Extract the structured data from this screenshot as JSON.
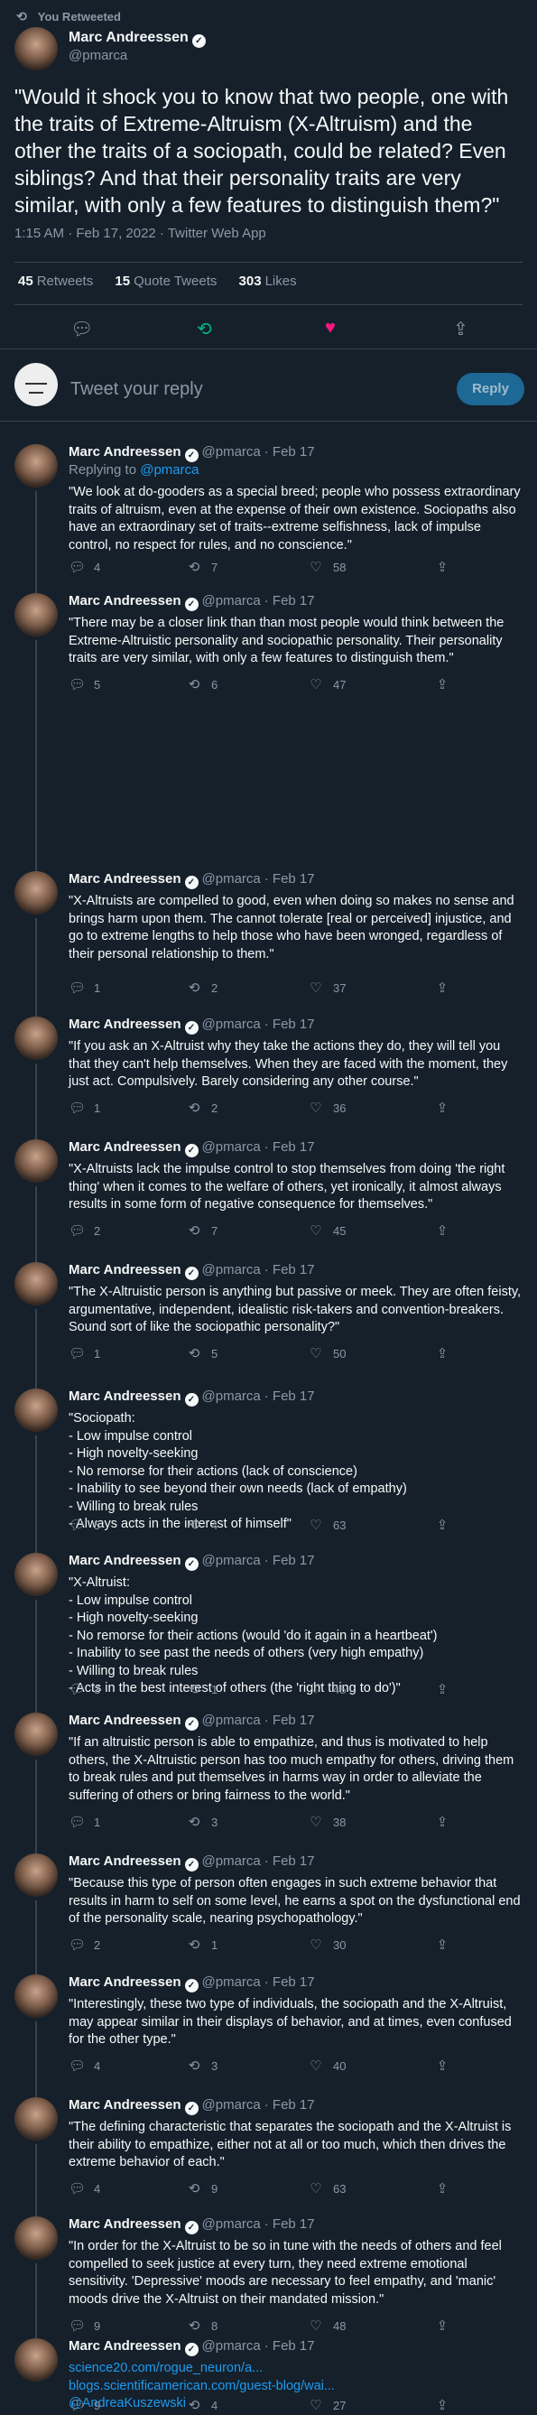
{
  "retweet_banner": "You Retweeted",
  "main": {
    "name": "Marc Andreessen",
    "handle": "@pmarca",
    "text": "\"Would it shock you to know that two people, one with the traits of Extreme-Altruism (X-Altruism) and the other the traits of a sociopath, could be related? Even siblings? And that their personality traits are very similar, with only a few features to distinguish them?\"",
    "meta": "1:15 AM · Feb 17, 2022 · Twitter Web App",
    "stats": {
      "retweets_count": "45",
      "retweets_label": "Retweets",
      "quotes_count": "15",
      "quotes_label": "Quote Tweets",
      "likes_count": "303",
      "likes_label": "Likes"
    },
    "retweet_color": "#00ba7c",
    "like_color": "#f91880"
  },
  "reply_box": {
    "placeholder": "Tweet your reply",
    "button": "Reply"
  },
  "replies": [
    {
      "name": "Marc Andreessen",
      "handle": "@pmarca",
      "date": "· Feb 17",
      "replying_label": "Replying to",
      "replying_to": "@pmarca",
      "text": "\"We look at do-gooders as a special breed; people who possess extraordinary traits of altruism, even at the expense of their own existence. Sociopaths also have an extraordinary set of traits--extreme selfishness, lack of impulse control, no respect for rules, and no conscience.\"",
      "replies": "4",
      "retweets": "7",
      "likes": "58"
    },
    {
      "name": "Marc Andreessen",
      "handle": "@pmarca",
      "date": "· Feb 17",
      "text": "\"There may be a closer link than than most people would think between the Extreme-Altruistic personality and sociopathic personality. Their personality traits are very similar, with only a few features to distinguish them.\"",
      "replies": "5",
      "retweets": "6",
      "likes": "47"
    },
    {
      "name": "Marc Andreessen",
      "handle": "@pmarca",
      "date": "· Feb 17",
      "text": "\"X-Altruists are compelled to good, even when doing so makes no sense and brings harm upon them. The cannot tolerate [real or perceived] injustice, and go to extreme lengths to help those who have been wronged, regardless of their personal relationship to them.\"",
      "replies": "1",
      "retweets": "2",
      "likes": "37"
    },
    {
      "name": "Marc Andreessen",
      "handle": "@pmarca",
      "date": "· Feb 17",
      "text": "\"If you ask an X-Altruist why they take the actions they do, they will tell you that they can't help themselves. When they are faced with the moment, they just act. Compulsively. Barely considering any other course.\"",
      "replies": "1",
      "retweets": "2",
      "likes": "36"
    },
    {
      "name": "Marc Andreessen",
      "handle": "@pmarca",
      "date": "· Feb 17",
      "text": "\"X-Altruists lack the impulse control to stop themselves from doing 'the right thing' when it comes to the welfare of others, yet ironically, it almost always results in some form of negative consequence for themselves.\"",
      "replies": "2",
      "retweets": "7",
      "likes": "45"
    },
    {
      "name": "Marc Andreessen",
      "handle": "@pmarca",
      "date": "· Feb 17",
      "text": "\"The X-Altruistic person is anything but passive or meek. They are often feisty, argumentative, independent, idealistic risk-takers and convention-breakers. Sound sort of like the sociopathic personality?\"",
      "replies": "1",
      "retweets": "5",
      "likes": "50"
    },
    {
      "name": "Marc Andreessen",
      "handle": "@pmarca",
      "date": "· Feb 17",
      "text": "\"Sociopath:\n- Low impulse control\n- High novelty-seeking\n- No remorse for their actions (lack of conscience)\n- Inability to see beyond their own needs (lack of empathy)\n- Willing to break rules\n- Always acts in the interest of himself\"",
      "replies": "5",
      "retweets": "4",
      "likes": "63"
    },
    {
      "name": "Marc Andreessen",
      "handle": "@pmarca",
      "date": "· Feb 17",
      "text": "\"X-Altruist:\n- Low impulse control\n- High novelty-seeking\n- No remorse for their actions (would 'do it again in a heartbeat')\n- Inability to see past the needs of others (very high empathy)\n- Willing to break rules\n- Acts in the best interest of others (the 'right thing to do')\"",
      "replies": "3",
      "retweets": "1",
      "likes": "45"
    },
    {
      "name": "Marc Andreessen",
      "handle": "@pmarca",
      "date": "· Feb 17",
      "text": "\"If an altruistic person is able to empathize, and thus is motivated to help others, the X-Altruistic person has too much empathy for others, driving them to break rules and put themselves in harms way in order to alleviate the suffering of others or bring fairness to the world.\"",
      "replies": "1",
      "retweets": "3",
      "likes": "38"
    },
    {
      "name": "Marc Andreessen",
      "handle": "@pmarca",
      "date": "· Feb 17",
      "text": "\"Because this type of person often engages in such extreme behavior that results in harm to self on some level, he earns a spot on the dysfunctional end of the personality scale, nearing psychopathology.\"",
      "replies": "2",
      "retweets": "1",
      "likes": "30"
    },
    {
      "name": "Marc Andreessen",
      "handle": "@pmarca",
      "date": "· Feb 17",
      "text": "\"Interestingly, these two type of individuals, the sociopath and the X-Altruist, may appear similar in their displays of behavior, and at times, even confused for the other type.\"",
      "replies": "4",
      "retweets": "3",
      "likes": "40"
    },
    {
      "name": "Marc Andreessen",
      "handle": "@pmarca",
      "date": "· Feb 17",
      "text": "\"The defining characteristic that separates the sociopath and the X-Altruist is their ability to empathize, either not at all or too much, which then drives the extreme behavior of each.\"",
      "replies": "4",
      "retweets": "9",
      "likes": "63"
    },
    {
      "name": "Marc Andreessen",
      "handle": "@pmarca",
      "date": "· Feb 17",
      "text": "\"In order for the X-Altruist to be so in tune with the needs of others and feel compelled to seek justice at every turn, they need extreme emotional sensitivity. 'Depressive' moods are necessary to feel empathy, and 'manic' moods drive the X-Altruist on their mandated mission.\"",
      "replies": "9",
      "retweets": "8",
      "likes": "48"
    },
    {
      "name": "Marc Andreessen",
      "handle": "@pmarca",
      "date": "· Feb 17",
      "text": "science20.com/rogue_neuron/a...\nblogs.scientificamerican.com/guest-blog/wai...\n@AndreaKuszewski",
      "link": true,
      "replies": "9",
      "retweets": "4",
      "likes": "27"
    }
  ]
}
